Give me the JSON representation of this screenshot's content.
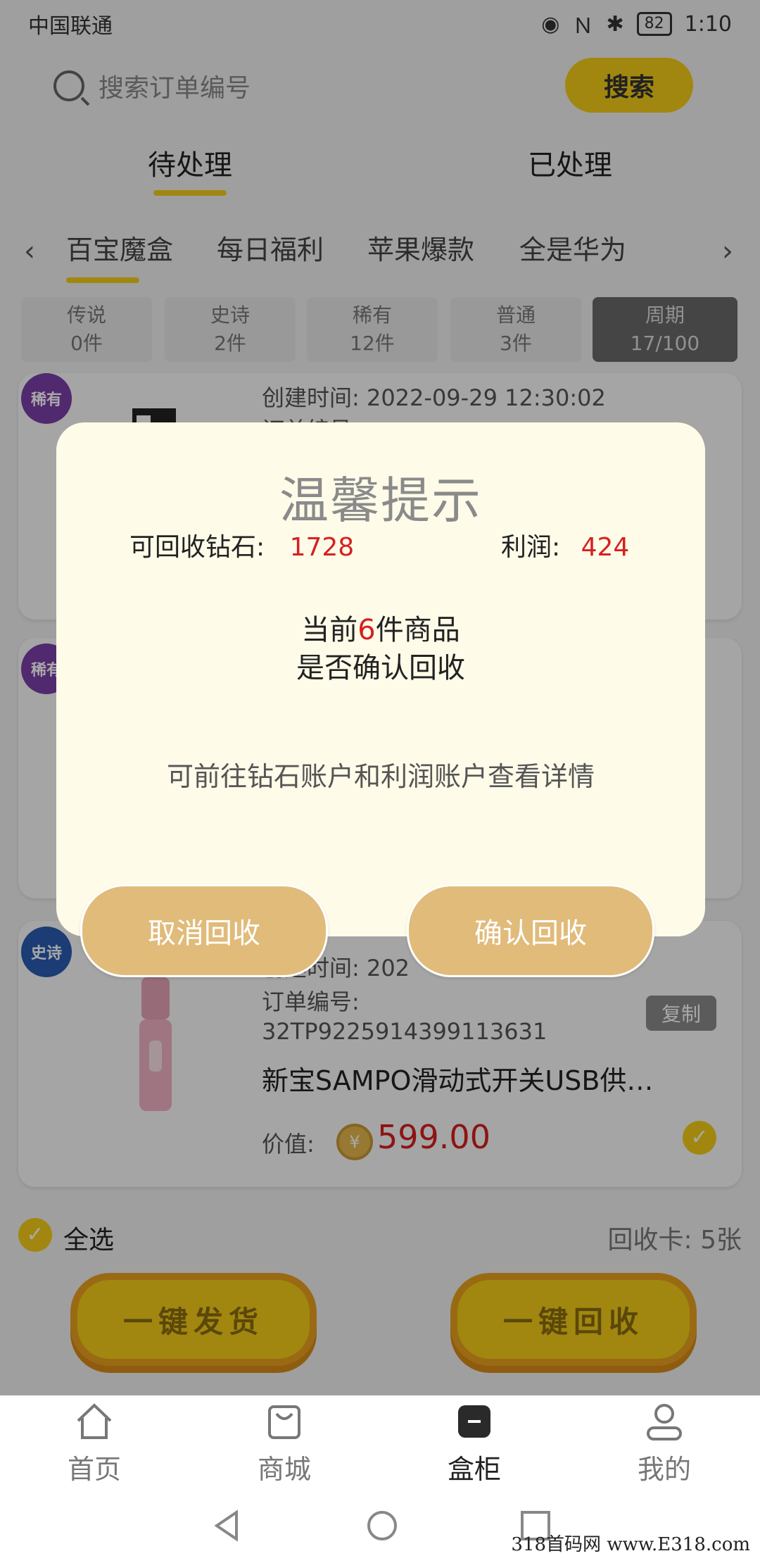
{
  "statusbar": {
    "carrier": "中国联通",
    "time": "1:10",
    "battery": "82"
  },
  "search": {
    "placeholder": "搜索订单编号",
    "button": "搜索"
  },
  "tabs": [
    "待处理",
    "已处理"
  ],
  "subtabs": [
    "百宝魔盒",
    "每日福利",
    "苹果爆款",
    "全是华为"
  ],
  "rarity": [
    {
      "name": "传说",
      "count": "0件"
    },
    {
      "name": "史诗",
      "count": "2件"
    },
    {
      "name": "稀有",
      "count": "12件"
    },
    {
      "name": "普通",
      "count": "3件"
    },
    {
      "name": "周期",
      "count": "17/100"
    }
  ],
  "cards": [
    {
      "badge": "稀有",
      "created": "创建时间: 2022-09-29 12:30:02",
      "order_label": "订单编号"
    },
    {
      "badge": "稀有"
    },
    {
      "badge": "史诗",
      "created": "创建时间: 202",
      "order_label": "订单编号:",
      "order_no": "32TP9225914399113631",
      "title": "新宝SAMPO滑动式开关USB供…",
      "price_label": "价值:",
      "price": "599.00",
      "copy": "复制"
    }
  ],
  "selection": {
    "select_all": "全选",
    "recycle_card": "回收卡: 5张"
  },
  "actions": {
    "ship": "一键发货",
    "recycle": "一键回收"
  },
  "bottom_nav": [
    "首页",
    "商城",
    "盒柜",
    "我的"
  ],
  "dialog": {
    "title": "温馨提示",
    "diamond_label": "可回收钻石:",
    "diamond_value": "1728",
    "profit_label": "利润:",
    "profit_value": "424",
    "line1_prefix": "当前",
    "line1_count": "6",
    "line1_suffix": "件商品",
    "line2": "是否确认回收",
    "note": "可前往钻石账户和利润账户查看详情",
    "cancel": "取消回收",
    "confirm": "确认回收"
  },
  "watermark": "318首码网 www.E318.com",
  "colors": {
    "accent": "#f4cd18",
    "price_red": "#d61f1f",
    "dialog_bg": "#fffbe9",
    "dialog_button": "#e0bb7a"
  }
}
